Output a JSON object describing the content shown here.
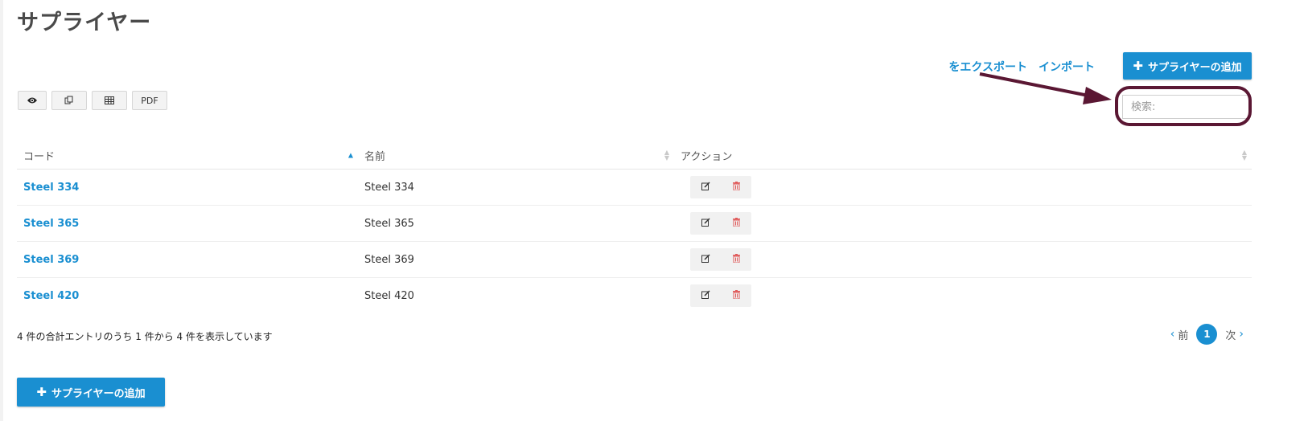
{
  "page": {
    "title": "サプライヤー"
  },
  "header": {
    "export_label": "をエクスポート",
    "import_label": "インポート",
    "add_label": "サプライヤーの追加"
  },
  "toolbar": {
    "pdf_label": "PDF"
  },
  "search": {
    "placeholder": "検索:",
    "value": ""
  },
  "table": {
    "columns": [
      "コード",
      "名前",
      "アクション"
    ],
    "rows": [
      {
        "code": "Steel 334",
        "name": "Steel 334"
      },
      {
        "code": "Steel 365",
        "name": "Steel 365"
      },
      {
        "code": "Steel 369",
        "name": "Steel 369"
      },
      {
        "code": "Steel 420",
        "name": "Steel 420"
      }
    ]
  },
  "footer": {
    "summary": "4 件の合計エントリのうち 1 件から 4 件を表示しています",
    "prev_label": "前",
    "current_page": "1",
    "next_label": "次",
    "add_label": "サプライヤーの追加"
  },
  "colors": {
    "accent": "#1a8fd1",
    "annotation": "#5a1733",
    "danger": "#e05a5a"
  }
}
